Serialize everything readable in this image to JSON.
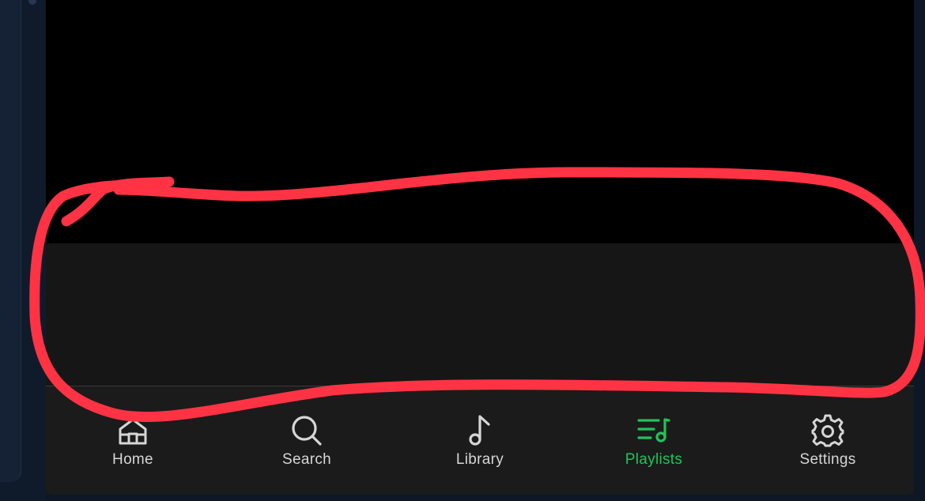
{
  "tab_bar": {
    "tabs": [
      {
        "label": "Home",
        "icon": "home-icon",
        "active": false
      },
      {
        "label": "Search",
        "icon": "search-icon",
        "active": false
      },
      {
        "label": "Library",
        "icon": "music-note-icon",
        "active": false
      },
      {
        "label": "Playlists",
        "icon": "playlist-icon",
        "active": true
      },
      {
        "label": "Settings",
        "icon": "gear-icon",
        "active": false
      }
    ]
  },
  "colors": {
    "active_tab": "#1fc35a",
    "inactive_tab": "#d6d6d6",
    "annotation": "#ff3344",
    "tab_bar_background": "#1b1b1b",
    "player_strip_background": "#161616"
  }
}
